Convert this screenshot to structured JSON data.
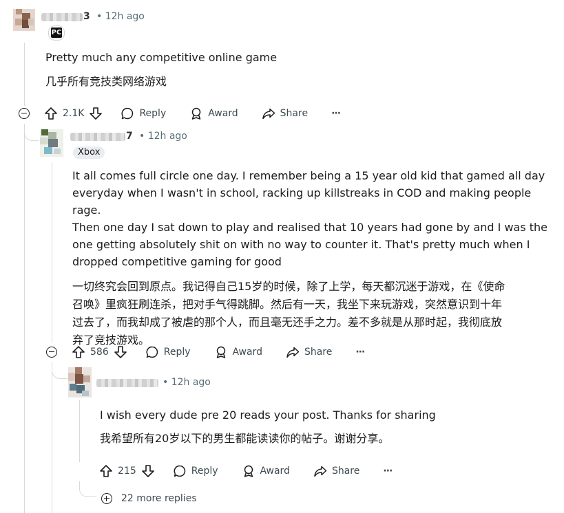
{
  "comments": [
    {
      "user_suffix": "3",
      "time": "• 12h ago",
      "flair": "PC",
      "text": "Pretty much any competitive online game",
      "translation": "几乎所有竞技类网络游戏",
      "votes": "2.1K",
      "reply_label": "Reply",
      "award_label": "Award",
      "share_label": "Share",
      "more_label": "···"
    },
    {
      "user_suffix": "7",
      "time": "• 12h ago",
      "flair": "Xbox",
      "text_lines": [
        "It all comes full circle one day. I remember being a 15 year old kid that gamed all day",
        "everyday when I wasn't in school, racking up killstreaks in COD and making people rage.",
        "Then one day I sat down to play and realised that 10 years had gone by and I was the",
        "one getting absolutely shit on with no way to counter it. That's pretty much when I",
        "dropped competitive gaming for good"
      ],
      "translation_lines": [
        "一切终究会回到原点。我记得自己15岁的时候，除了上学，每天都沉迷于游戏，在《使命",
        "召唤》里疯狂刷连杀，把对手气得跳脚。然后有一天，我坐下来玩游戏，突然意识到十年",
        "过去了，而我却成了被虐的那个人，而且毫无还手之力。差不多就是从那时起，我彻底放",
        "弃了竞技游戏。"
      ],
      "votes": "586",
      "reply_label": "Reply",
      "award_label": "Award",
      "share_label": "Share",
      "more_label": "···"
    },
    {
      "time": "• 12h ago",
      "text": "I wish every dude pre 20 reads your post. Thanks for sharing",
      "translation": "我希望所有20岁以下的男生都能读读你的帖子。谢谢分享。",
      "votes": "215",
      "reply_label": "Reply",
      "award_label": "Award",
      "share_label": "Share",
      "more_label": "···"
    }
  ],
  "more_replies": "22 more replies"
}
